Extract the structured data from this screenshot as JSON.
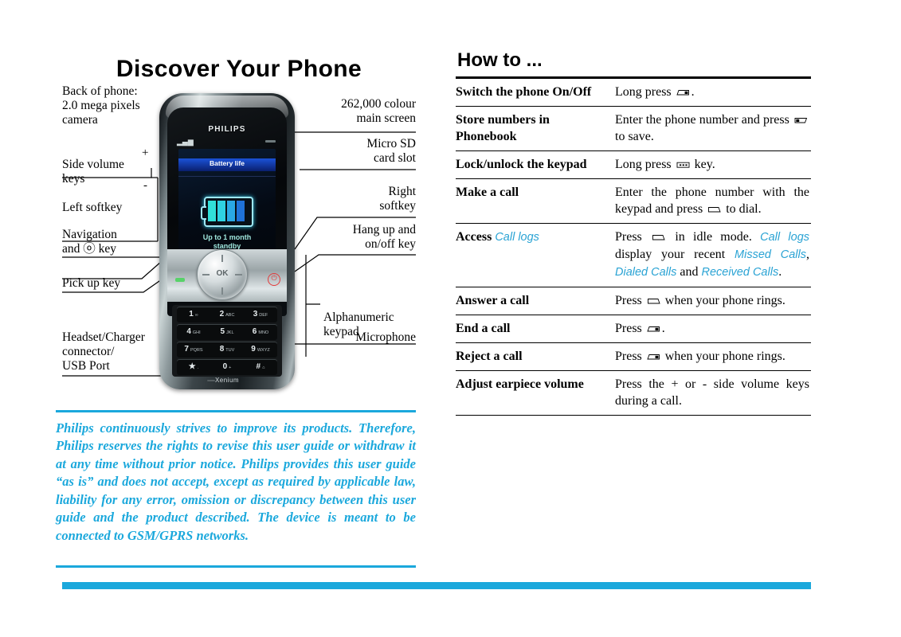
{
  "left": {
    "title": "Discover Your Phone",
    "callouts_left": [
      {
        "name": "back-camera",
        "text": "Back of phone:\n2.0 mega pixels\ncamera"
      },
      {
        "name": "side-volume",
        "text": "Side volume\nkeys"
      },
      {
        "name": "left-softkey",
        "text": "Left softkey"
      },
      {
        "name": "navigation",
        "text": "Navigation\nand ⓞ key"
      },
      {
        "name": "pick-up-key",
        "text": "Pick up key"
      },
      {
        "name": "headset-usb",
        "text": "Headset/Charger\nconnector/\nUSB Port"
      }
    ],
    "volume_plus": "+",
    "volume_minus": "-",
    "callouts_right": [
      {
        "name": "main-screen",
        "text": "262,000 colour\nmain screen"
      },
      {
        "name": "micro-sd",
        "text": "Micro SD\ncard slot"
      },
      {
        "name": "right-softkey",
        "text": "Right\nsoftkey"
      },
      {
        "name": "hang-up-key",
        "text": "Hang up and\non/off key"
      },
      {
        "name": "alphanumeric",
        "text": "Alphanumeric\nkeypad"
      },
      {
        "name": "microphone",
        "text": "Microphone"
      }
    ],
    "phone": {
      "brand": "PHILIPS",
      "sub_brand": "Xenium",
      "screen_title": "Battery life",
      "screen_standby": "Up to 1 month\nstandby",
      "ok_label": "OK",
      "keypad": [
        [
          {
            "big": "1",
            "sm": "∞"
          },
          {
            "big": "2",
            "sm": "ABC"
          },
          {
            "big": "3",
            "sm": "DEF"
          }
        ],
        [
          {
            "big": "4",
            "sm": "GHI"
          },
          {
            "big": "5",
            "sm": "JKL"
          },
          {
            "big": "6",
            "sm": "MNO"
          }
        ],
        [
          {
            "big": "7",
            "sm": "PQRS"
          },
          {
            "big": "8",
            "sm": "TUV"
          },
          {
            "big": "9",
            "sm": "WXYZ"
          }
        ],
        [
          {
            "big": "★",
            "sm": "."
          },
          {
            "big": "0",
            "sm": "+"
          },
          {
            "big": "#",
            "sm": "⌂"
          }
        ]
      ]
    },
    "legal_text": "Philips continuously strives to improve its products. Therefore, Philips reserves the rights to revise this user guide or withdraw it at any time without prior notice. Philips provides this user guide “as is” and does not accept, except as required by applicable law, liability for any error, omission or discrepancy between this user guide and the product described. The device is meant to be connected to GSM/GPRS networks."
  },
  "right": {
    "title": "How to ...",
    "rows": [
      {
        "name": "switch-on-off",
        "key": "Switch the phone On/Off",
        "parts": [
          {
            "t": "text",
            "v": "Long press "
          },
          {
            "t": "icon",
            "v": "hangup-key-icon"
          },
          {
            "t": "text",
            "v": "."
          }
        ]
      },
      {
        "name": "store-numbers",
        "key": "Store numbers in Phonebook",
        "parts": [
          {
            "t": "text",
            "v": "Enter the phone number and press "
          },
          {
            "t": "icon",
            "v": "right-softkey-icon"
          },
          {
            "t": "text",
            "v": " to save."
          }
        ]
      },
      {
        "name": "lock-unlock-keypad",
        "key": "Lock/unlock the keypad",
        "parts": [
          {
            "t": "text",
            "v": "Long press "
          },
          {
            "t": "icon",
            "v": "star-key-icon"
          },
          {
            "t": "text",
            "v": " key."
          }
        ]
      },
      {
        "name": "make-a-call",
        "key": "Make a call",
        "parts": [
          {
            "t": "text",
            "v": "Enter the phone number with the keypad and press "
          },
          {
            "t": "icon",
            "v": "pickup-key-icon"
          },
          {
            "t": "text",
            "v": " to dial."
          }
        ]
      },
      {
        "name": "access-call-logs",
        "key_parts": [
          {
            "t": "text",
            "v": "Access "
          },
          {
            "t": "hi",
            "v": "Call logs"
          }
        ],
        "parts": [
          {
            "t": "text",
            "v": "Press "
          },
          {
            "t": "icon",
            "v": "pickup-key-icon"
          },
          {
            "t": "text",
            "v": " in idle mode. "
          },
          {
            "t": "hi",
            "v": "Call logs"
          },
          {
            "t": "text",
            "v": " display your recent "
          },
          {
            "t": "hi",
            "v": "Missed Calls"
          },
          {
            "t": "text",
            "v": ", "
          },
          {
            "t": "hi",
            "v": "Dialed Calls"
          },
          {
            "t": "text",
            "v": " and "
          },
          {
            "t": "hi",
            "v": "Received Calls"
          },
          {
            "t": "text",
            "v": "."
          }
        ]
      },
      {
        "name": "answer-a-call",
        "key": "Answer a call",
        "parts": [
          {
            "t": "text",
            "v": "Press "
          },
          {
            "t": "icon",
            "v": "pickup-key-icon"
          },
          {
            "t": "text",
            "v": " when your phone rings."
          }
        ]
      },
      {
        "name": "end-a-call",
        "key": "End a call",
        "parts": [
          {
            "t": "text",
            "v": "Press "
          },
          {
            "t": "icon",
            "v": "hangup-key-icon"
          },
          {
            "t": "text",
            "v": "."
          }
        ]
      },
      {
        "name": "reject-a-call",
        "key": "Reject a call",
        "parts": [
          {
            "t": "text",
            "v": "Press "
          },
          {
            "t": "icon",
            "v": "hangup-key-icon"
          },
          {
            "t": "text",
            "v": " when your phone rings."
          }
        ]
      },
      {
        "name": "adjust-earpiece-volume",
        "key": "Adjust earpiece volume",
        "parts": [
          {
            "t": "text",
            "v": "Press the + or - side volume keys during a call."
          }
        ]
      }
    ]
  },
  "colors": {
    "accent_blue": "#1ba8dc",
    "link_blue": "#2aa3d4",
    "rule_black": "#000000"
  }
}
